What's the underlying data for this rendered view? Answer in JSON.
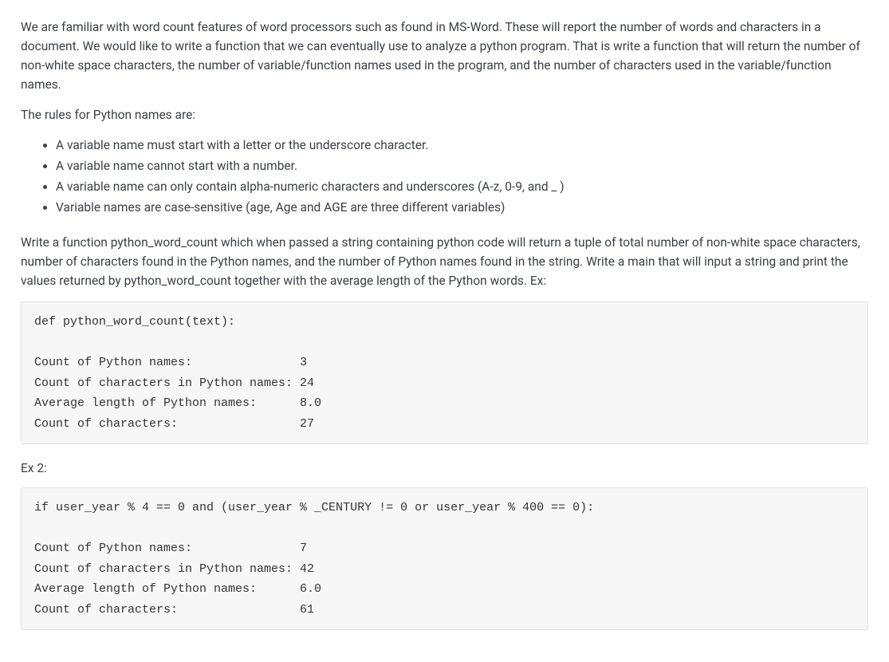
{
  "paragraphs": {
    "intro": "We are familiar with word count features of word processors such as found in MS-Word. These will report the number of words and characters in a document. We would like to write a function that we can eventually use to analyze a python program. That is write a function that will return the number of non-white space characters, the number of variable/function names used in the program, and the number of characters used in the variable/function names.",
    "rules_heading": "The rules for Python names are:",
    "task": "Write a function python_word_count which when passed a string containing python code will return a tuple of total number of non-white space characters, number of characters found in the Python names, and the number of Python names found in the string. Write a main that will input a string and print the values returned by python_word_count together with the average length of the Python words. Ex:",
    "ex2_label": "Ex 2:"
  },
  "rules": [
    "A variable name must start with a letter or the underscore character.",
    "A variable name cannot start with a number.",
    "A variable name can only contain alpha-numeric characters and underscores (A-z, 0-9, and _ )",
    "Variable names are case-sensitive (age, Age and AGE are three different variables)"
  ],
  "code1": "def python_word_count(text):\n\nCount of Python names:               3\nCount of characters in Python names: 24\nAverage length of Python names:      8.0\nCount of characters:                 27",
  "code2": "if user_year % 4 == 0 and (user_year % _CENTURY != 0 or user_year % 400 == 0):\n\nCount of Python names:               7\nCount of characters in Python names: 42\nAverage length of Python names:      6.0\nCount of characters:                 61"
}
